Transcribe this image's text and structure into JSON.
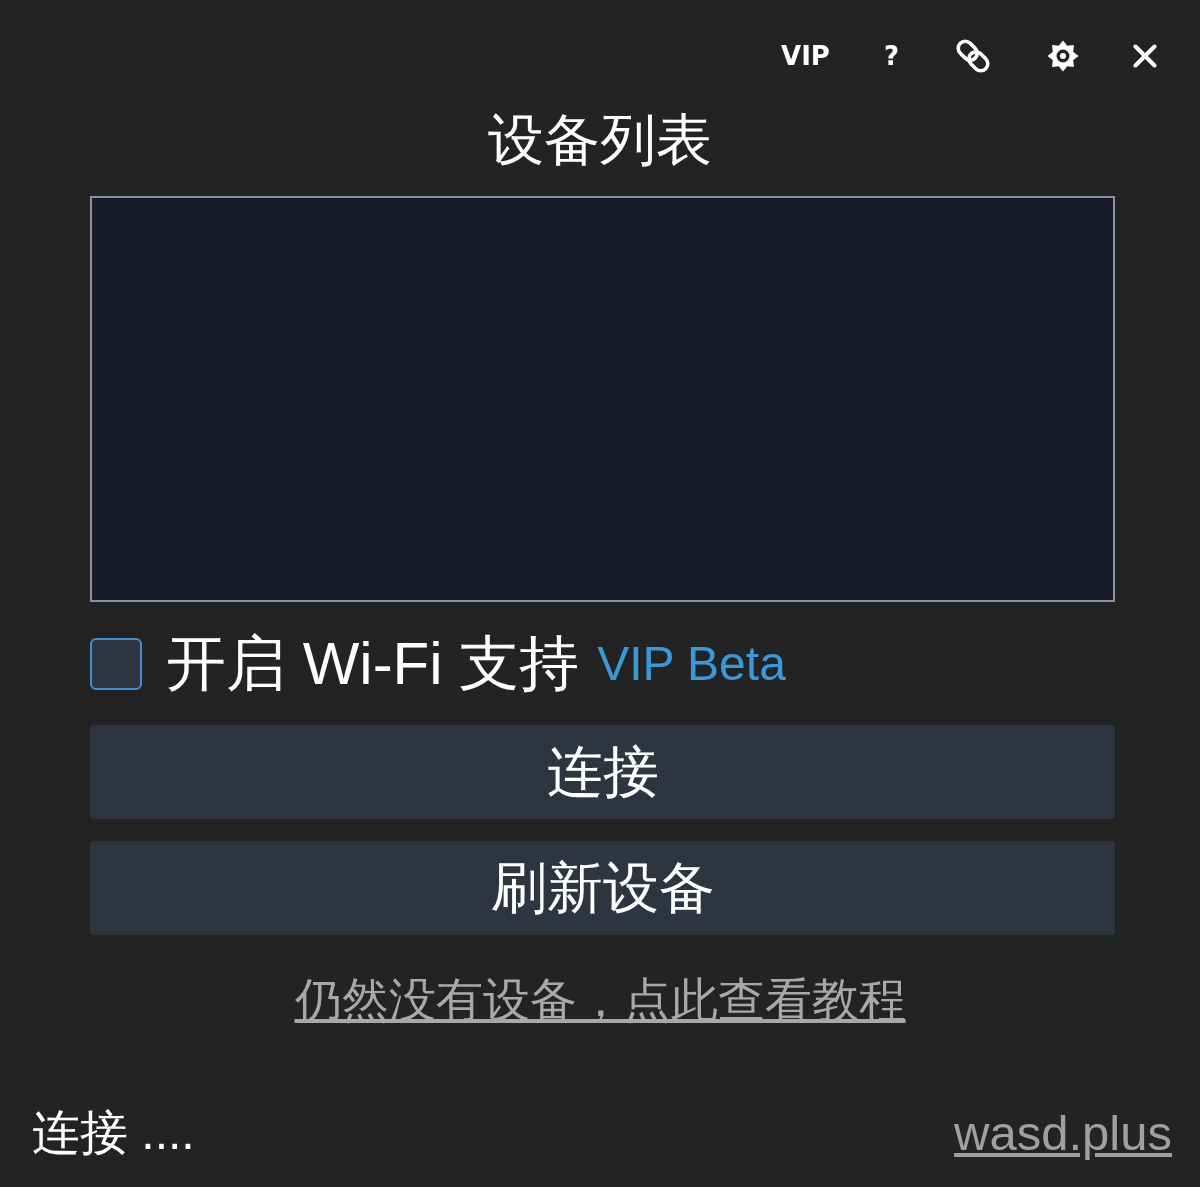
{
  "toolbar": [
    {
      "kind": "vip",
      "label": "VIP"
    },
    {
      "kind": "help",
      "label": "?"
    },
    {
      "kind": "link"
    },
    {
      "kind": "settings"
    },
    {
      "kind": "close"
    }
  ],
  "title": "设备列表",
  "wifi_option": {
    "label": "开启 Wi-Fi 支持",
    "badge": "VIP Beta",
    "checked": false
  },
  "buttons": [
    "连接",
    "刷新设备"
  ],
  "help_link": "仍然没有设备，点此查看教程",
  "status_bar": {
    "status": "连接 ....",
    "site_link": "wasd.plus"
  }
}
